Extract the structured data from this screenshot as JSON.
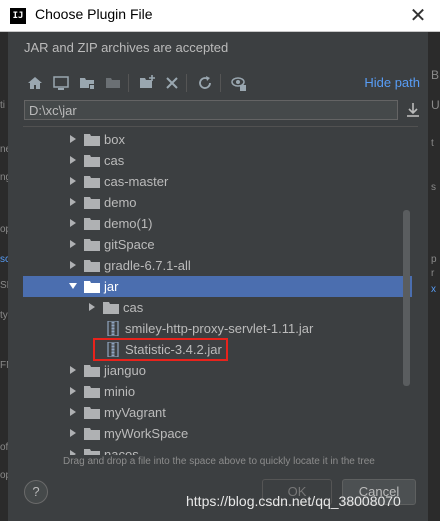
{
  "window": {
    "title": "Choose Plugin File",
    "app_icon_text": "IJ",
    "close_glyph": "✕"
  },
  "description": "JAR and ZIP archives are accepted",
  "toolbar": {
    "icons": [
      "home-icon",
      "desktop-icon",
      "project-folder-icon",
      "module-folder-icon",
      "new-folder-icon",
      "delete-icon",
      "refresh-icon",
      "show-hidden-icon"
    ],
    "hide_path": "Hide path"
  },
  "path": {
    "value": "D:\\xc\\jar"
  },
  "tree": {
    "rows": [
      {
        "label": "box",
        "type": "folder",
        "expanded": false,
        "depth": 1
      },
      {
        "label": "cas",
        "type": "folder",
        "expanded": false,
        "depth": 1
      },
      {
        "label": "cas-master",
        "type": "folder",
        "expanded": false,
        "depth": 1
      },
      {
        "label": "demo",
        "type": "folder",
        "expanded": false,
        "depth": 1
      },
      {
        "label": "demo(1)",
        "type": "folder",
        "expanded": false,
        "depth": 1
      },
      {
        "label": "gitSpace",
        "type": "folder",
        "expanded": false,
        "depth": 1
      },
      {
        "label": "gradle-6.7.1-all",
        "type": "folder",
        "expanded": false,
        "depth": 1
      },
      {
        "label": "jar",
        "type": "folder",
        "expanded": true,
        "depth": 1,
        "selected": true
      },
      {
        "label": "cas",
        "type": "folder",
        "expanded": false,
        "depth": 2
      },
      {
        "label": "smiley-http-proxy-servlet-1.11.jar",
        "type": "jar",
        "depth": 2
      },
      {
        "label": "Statistic-3.4.2.jar",
        "type": "jar",
        "depth": 2,
        "highlighted": true
      },
      {
        "label": "jianguo",
        "type": "folder",
        "expanded": false,
        "depth": 1
      },
      {
        "label": "minio",
        "type": "folder",
        "expanded": false,
        "depth": 1
      },
      {
        "label": "myVagrant",
        "type": "folder",
        "expanded": false,
        "depth": 1
      },
      {
        "label": "myWorkSpace",
        "type": "folder",
        "expanded": false,
        "depth": 1
      },
      {
        "label": "nacos",
        "type": "folder",
        "expanded": false,
        "depth": 1
      }
    ]
  },
  "hint": "Drag and drop a file into the space above to quickly locate it in the tree",
  "buttons": {
    "help": "?",
    "ok": "OK",
    "cancel": "Cancel"
  },
  "watermark": "https://blog.csdn.net/qq_38008070",
  "colors": {
    "background": "#3c3f41",
    "selection": "#4b6eaf",
    "link": "#589df6",
    "highlight_border": "#e8231c",
    "folder": "#afb1b3"
  },
  "background_window_glyphs": {
    "left": [
      "ti",
      "ne",
      "ng",
      "sc",
      "op",
      "SF",
      "ty",
      "FM",
      "of",
      "op"
    ],
    "right": [
      "B",
      "U",
      "t",
      "s",
      "p",
      "r",
      "x"
    ]
  }
}
